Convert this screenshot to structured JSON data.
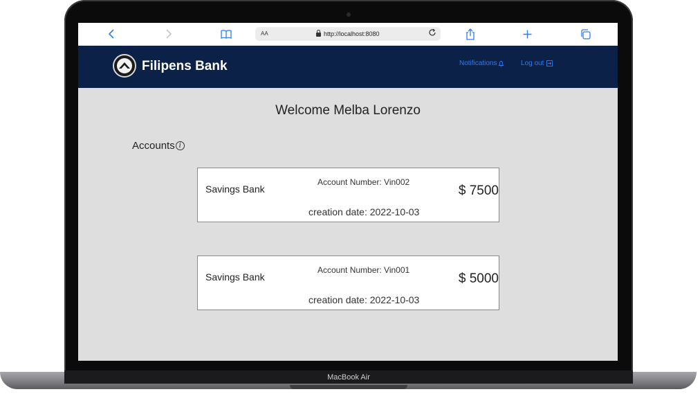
{
  "device": {
    "model_label": "MacBook Air"
  },
  "browser": {
    "reader_label": "AA",
    "url": "http://localhost:8080"
  },
  "header": {
    "brand": "Filipens Bank",
    "notifications_label": "Notifications",
    "logout_label": "Log out"
  },
  "main": {
    "welcome": "Welcome Melba Lorenzo",
    "accounts_label": "Accounts",
    "accounts": [
      {
        "type": "Savings Bank",
        "number": "Account Number: Vin002",
        "balance": "$ 7500",
        "date": "creation date: 2022-10-03"
      },
      {
        "type": "Savings Bank",
        "number": "Account Number: Vin001",
        "balance": "$ 5000",
        "date": "creation date: 2022-10-03"
      }
    ]
  },
  "colors": {
    "header_bg": "#0b2148",
    "link": "#2f7bf5",
    "page_bg": "#dedede"
  }
}
